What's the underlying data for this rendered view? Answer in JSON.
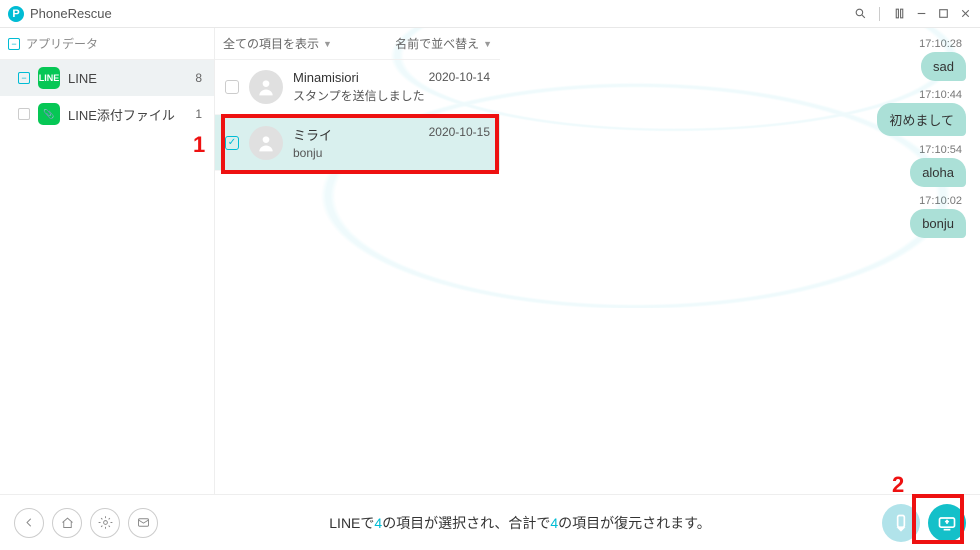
{
  "titlebar": {
    "app_name": "PhoneRescue"
  },
  "sidebar": {
    "header": "アプリデータ",
    "items": [
      {
        "label": "LINE",
        "count": "8"
      },
      {
        "label": "LINE添付ファイル",
        "count": "1"
      }
    ]
  },
  "list_controls": {
    "show_all": "全ての項目を表示",
    "sort": "名前で並べ替え"
  },
  "conversations": [
    {
      "name": "Minamisiori",
      "date": "2020-10-14",
      "preview": "スタンプを送信しました"
    },
    {
      "name": "ミライ",
      "date": "2020-10-15",
      "preview": "bonju"
    }
  ],
  "messages": [
    {
      "time": "17:10:28",
      "text": "sad"
    },
    {
      "time": "17:10:44",
      "text": "初めまして"
    },
    {
      "time": "17:10:54",
      "text": "aloha"
    },
    {
      "time": "17:10:02",
      "text": "bonju"
    }
  ],
  "footer": {
    "status_prefix": "LINEで",
    "status_mid1": "の項目が選択され、合計で",
    "status_suffix": "の項目が復元されます。",
    "selected_count": "4",
    "total_count": "4"
  },
  "annotations": {
    "label1": "1",
    "label2": "2"
  }
}
